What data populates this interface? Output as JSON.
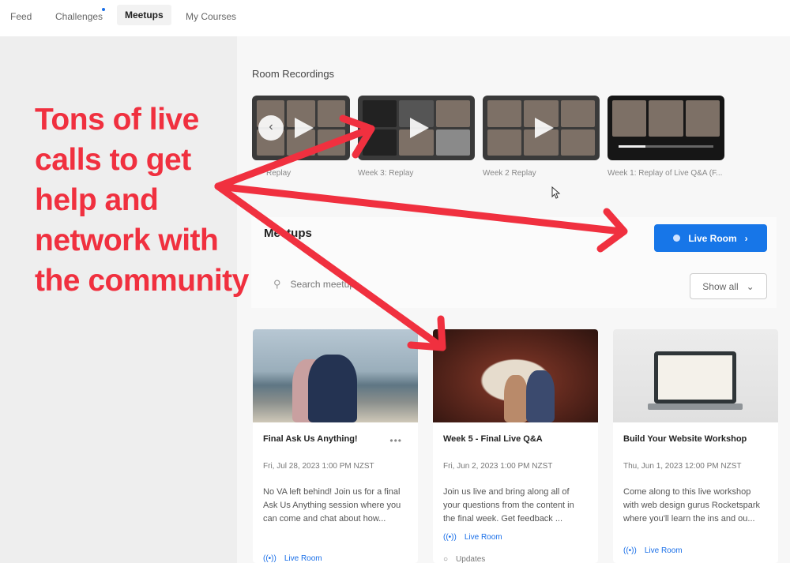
{
  "nav": {
    "tabs": [
      {
        "label": "Feed"
      },
      {
        "label": "Challenges"
      },
      {
        "label": "Meetups"
      },
      {
        "label": "My Courses"
      }
    ],
    "active": "Meetups"
  },
  "recordings": {
    "title": "Room Recordings",
    "items": [
      {
        "caption": "Replay"
      },
      {
        "caption": "Week 3: Replay"
      },
      {
        "caption": "Week 2 Replay"
      },
      {
        "caption": "Week 1: Replay of Live Q&A (F..."
      }
    ]
  },
  "meetups": {
    "title": "Meetups",
    "live_room_button": "Live Room",
    "search_placeholder": "Search meetups",
    "filter_label": "Show all",
    "cards": [
      {
        "title": "Final Ask Us Anything!",
        "date": "Fri, Jul 28, 2023 1:00 PM NZST",
        "description": "No VA left behind! Join us for a final Ask Us Anything session where you can come and chat about how...",
        "live_label": "Live Room"
      },
      {
        "title": "Week 5 - Final Live Q&A",
        "date": "Fri, Jun 2, 2023 1:00 PM NZST",
        "description": "Join us live and bring along all of your questions from the content in the final week. Get feedback ...",
        "live_label": "Live Room",
        "extra_label": "Updates"
      },
      {
        "title": "Build Your Website Workshop",
        "date": "Thu, Jun 1, 2023 12:00 PM NZST",
        "description": "Come along to this live workshop with web design gurus Rocketspark where you'll learn the ins and ou...",
        "live_label": "Live Room"
      }
    ]
  },
  "annotation": {
    "lines": [
      "Tons of live",
      "calls to get",
      "help and",
      "network with",
      "the community"
    ],
    "color": "#f0303f"
  },
  "colors": {
    "accent": "#1776e8",
    "notification_dot": "#1a6fe8"
  }
}
